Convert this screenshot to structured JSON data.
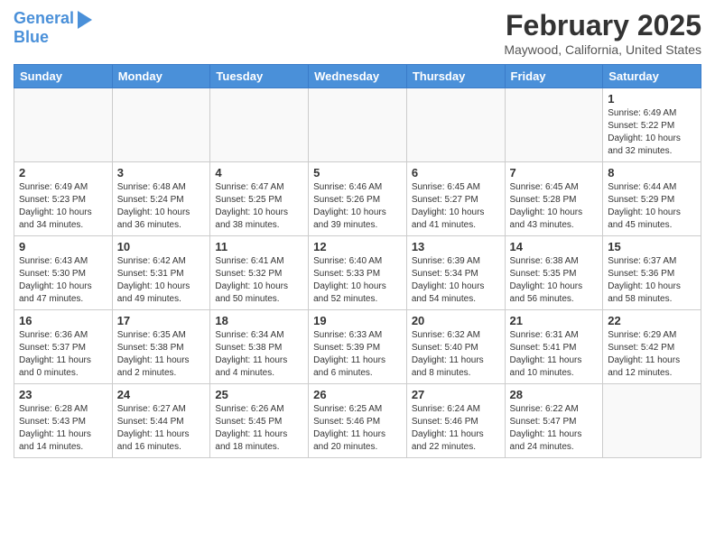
{
  "header": {
    "logo_line1": "General",
    "logo_line2": "Blue",
    "title": "February 2025",
    "subtitle": "Maywood, California, United States"
  },
  "days_of_week": [
    "Sunday",
    "Monday",
    "Tuesday",
    "Wednesday",
    "Thursday",
    "Friday",
    "Saturday"
  ],
  "weeks": [
    [
      {
        "day": "",
        "info": ""
      },
      {
        "day": "",
        "info": ""
      },
      {
        "day": "",
        "info": ""
      },
      {
        "day": "",
        "info": ""
      },
      {
        "day": "",
        "info": ""
      },
      {
        "day": "",
        "info": ""
      },
      {
        "day": "1",
        "info": "Sunrise: 6:49 AM\nSunset: 5:22 PM\nDaylight: 10 hours and 32 minutes."
      }
    ],
    [
      {
        "day": "2",
        "info": "Sunrise: 6:49 AM\nSunset: 5:23 PM\nDaylight: 10 hours and 34 minutes."
      },
      {
        "day": "3",
        "info": "Sunrise: 6:48 AM\nSunset: 5:24 PM\nDaylight: 10 hours and 36 minutes."
      },
      {
        "day": "4",
        "info": "Sunrise: 6:47 AM\nSunset: 5:25 PM\nDaylight: 10 hours and 38 minutes."
      },
      {
        "day": "5",
        "info": "Sunrise: 6:46 AM\nSunset: 5:26 PM\nDaylight: 10 hours and 39 minutes."
      },
      {
        "day": "6",
        "info": "Sunrise: 6:45 AM\nSunset: 5:27 PM\nDaylight: 10 hours and 41 minutes."
      },
      {
        "day": "7",
        "info": "Sunrise: 6:45 AM\nSunset: 5:28 PM\nDaylight: 10 hours and 43 minutes."
      },
      {
        "day": "8",
        "info": "Sunrise: 6:44 AM\nSunset: 5:29 PM\nDaylight: 10 hours and 45 minutes."
      }
    ],
    [
      {
        "day": "9",
        "info": "Sunrise: 6:43 AM\nSunset: 5:30 PM\nDaylight: 10 hours and 47 minutes."
      },
      {
        "day": "10",
        "info": "Sunrise: 6:42 AM\nSunset: 5:31 PM\nDaylight: 10 hours and 49 minutes."
      },
      {
        "day": "11",
        "info": "Sunrise: 6:41 AM\nSunset: 5:32 PM\nDaylight: 10 hours and 50 minutes."
      },
      {
        "day": "12",
        "info": "Sunrise: 6:40 AM\nSunset: 5:33 PM\nDaylight: 10 hours and 52 minutes."
      },
      {
        "day": "13",
        "info": "Sunrise: 6:39 AM\nSunset: 5:34 PM\nDaylight: 10 hours and 54 minutes."
      },
      {
        "day": "14",
        "info": "Sunrise: 6:38 AM\nSunset: 5:35 PM\nDaylight: 10 hours and 56 minutes."
      },
      {
        "day": "15",
        "info": "Sunrise: 6:37 AM\nSunset: 5:36 PM\nDaylight: 10 hours and 58 minutes."
      }
    ],
    [
      {
        "day": "16",
        "info": "Sunrise: 6:36 AM\nSunset: 5:37 PM\nDaylight: 11 hours and 0 minutes."
      },
      {
        "day": "17",
        "info": "Sunrise: 6:35 AM\nSunset: 5:38 PM\nDaylight: 11 hours and 2 minutes."
      },
      {
        "day": "18",
        "info": "Sunrise: 6:34 AM\nSunset: 5:38 PM\nDaylight: 11 hours and 4 minutes."
      },
      {
        "day": "19",
        "info": "Sunrise: 6:33 AM\nSunset: 5:39 PM\nDaylight: 11 hours and 6 minutes."
      },
      {
        "day": "20",
        "info": "Sunrise: 6:32 AM\nSunset: 5:40 PM\nDaylight: 11 hours and 8 minutes."
      },
      {
        "day": "21",
        "info": "Sunrise: 6:31 AM\nSunset: 5:41 PM\nDaylight: 11 hours and 10 minutes."
      },
      {
        "day": "22",
        "info": "Sunrise: 6:29 AM\nSunset: 5:42 PM\nDaylight: 11 hours and 12 minutes."
      }
    ],
    [
      {
        "day": "23",
        "info": "Sunrise: 6:28 AM\nSunset: 5:43 PM\nDaylight: 11 hours and 14 minutes."
      },
      {
        "day": "24",
        "info": "Sunrise: 6:27 AM\nSunset: 5:44 PM\nDaylight: 11 hours and 16 minutes."
      },
      {
        "day": "25",
        "info": "Sunrise: 6:26 AM\nSunset: 5:45 PM\nDaylight: 11 hours and 18 minutes."
      },
      {
        "day": "26",
        "info": "Sunrise: 6:25 AM\nSunset: 5:46 PM\nDaylight: 11 hours and 20 minutes."
      },
      {
        "day": "27",
        "info": "Sunrise: 6:24 AM\nSunset: 5:46 PM\nDaylight: 11 hours and 22 minutes."
      },
      {
        "day": "28",
        "info": "Sunrise: 6:22 AM\nSunset: 5:47 PM\nDaylight: 11 hours and 24 minutes."
      },
      {
        "day": "",
        "info": ""
      }
    ]
  ]
}
